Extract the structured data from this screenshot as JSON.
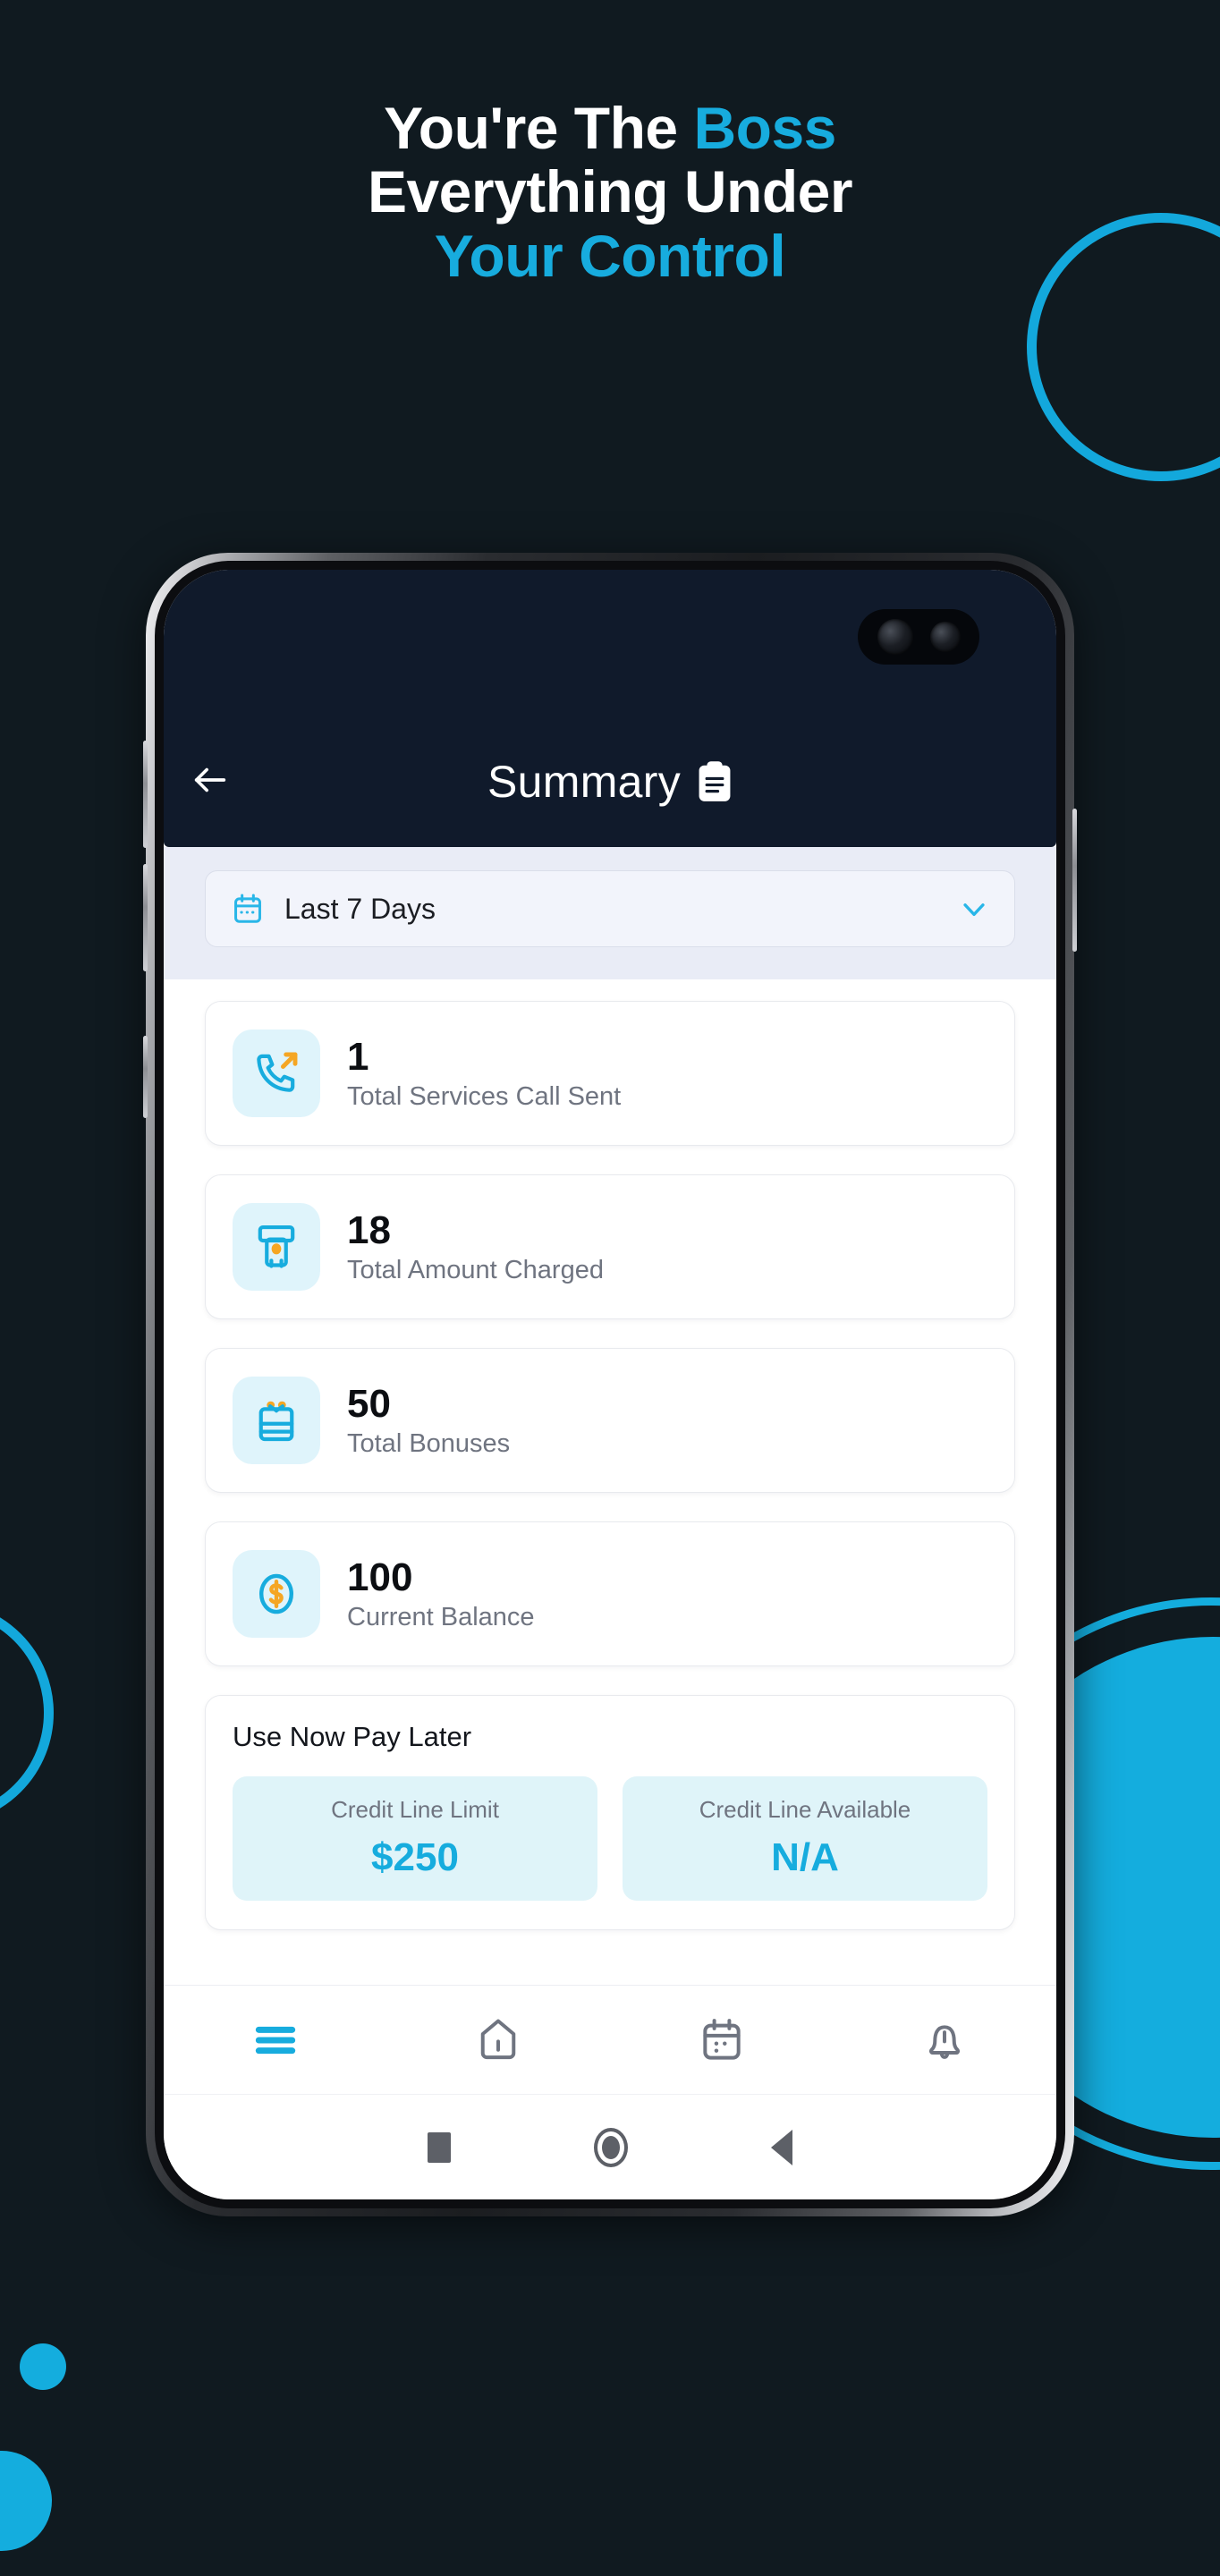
{
  "promo": {
    "headline_line1_white": "You're The ",
    "headline_line1_accent": "Boss",
    "headline_line2": "Everything Under",
    "headline_line3": "Your Control",
    "accent_color": "#17ACDE",
    "background_color": "#101A20"
  },
  "app": {
    "header": {
      "back_icon": "arrow-left-icon",
      "title": "Summary",
      "title_icon": "clipboard-icon"
    },
    "filter": {
      "calendar_icon": "calendar-icon",
      "selected_value": "Last 7 Days",
      "chevron_icon": "chevron-down-icon"
    },
    "stats": [
      {
        "value": "1",
        "label": "Total Services Call Sent",
        "icon": "outgoing-call-icon"
      },
      {
        "value": "18",
        "label": "Total Amount Charged",
        "icon": "atm-cash-icon"
      },
      {
        "value": "50",
        "label": "Total Bonuses",
        "icon": "gift-icon"
      },
      {
        "value": "100",
        "label": "Current Balance",
        "icon": "dollar-coin-icon"
      }
    ],
    "use_now_pay_later": {
      "title": "Use Now Pay Later",
      "tiles": [
        {
          "label": "Credit Line Limit",
          "value": "$250"
        },
        {
          "label": "Credit Line Available",
          "value": "N/A"
        }
      ]
    },
    "bottom_nav": [
      {
        "icon": "menu-icon",
        "active": true
      },
      {
        "icon": "home-icon",
        "active": false
      },
      {
        "icon": "calendar-icon",
        "active": false
      },
      {
        "icon": "bell-icon",
        "active": false
      }
    ],
    "system_nav": [
      {
        "icon": "recents-square-icon"
      },
      {
        "icon": "home-circle-icon"
      },
      {
        "icon": "back-triangle-icon"
      }
    ]
  }
}
